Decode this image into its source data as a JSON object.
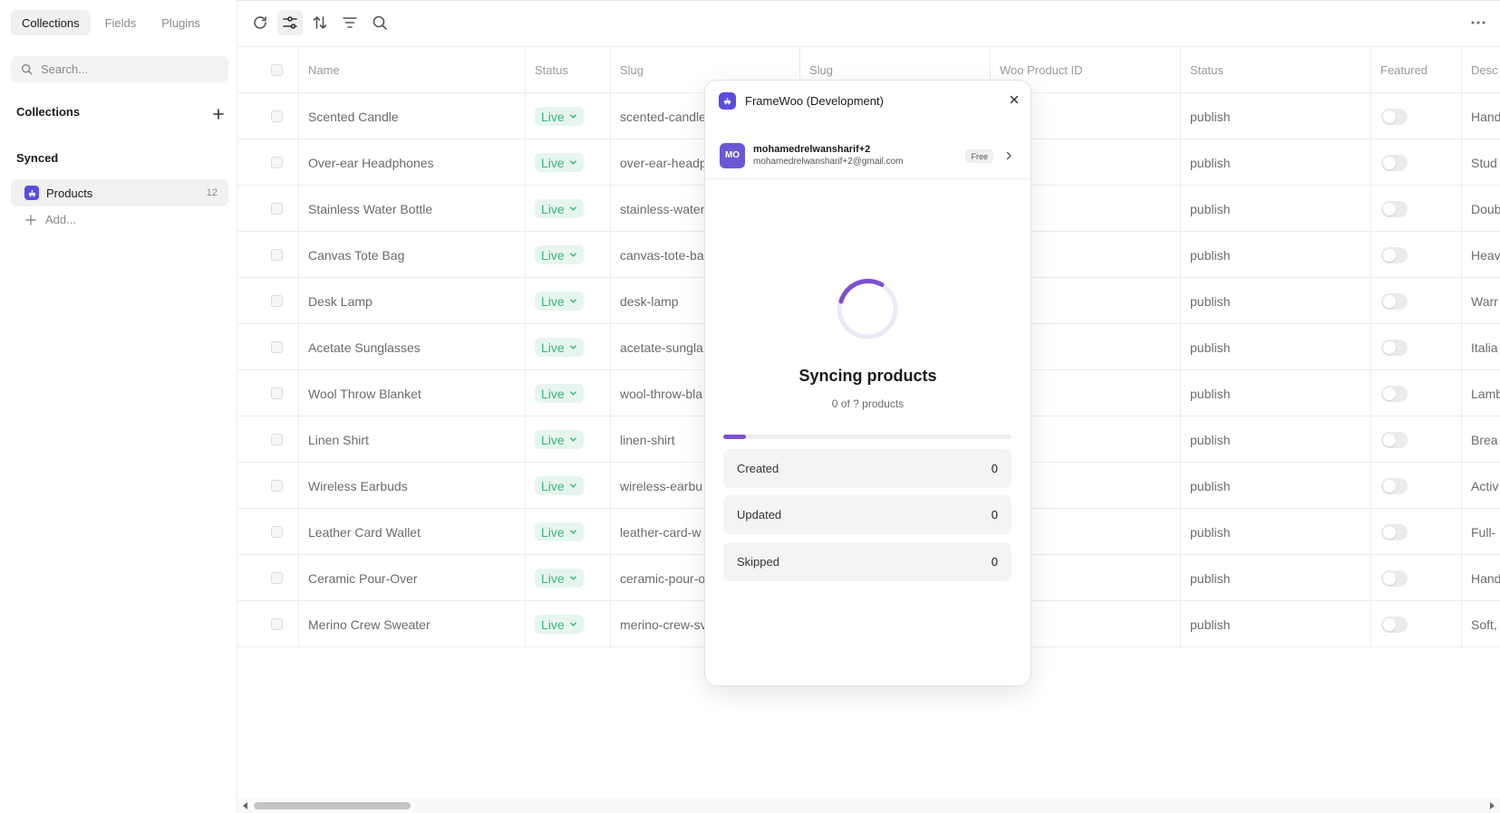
{
  "sidebar": {
    "tabs": [
      {
        "label": "Collections",
        "active": true
      },
      {
        "label": "Fields",
        "active": false
      },
      {
        "label": "Plugins",
        "active": false
      }
    ],
    "search_placeholder": "Search...",
    "collections_heading": "Collections",
    "synced_heading": "Synced",
    "synced_item": {
      "label": "Products",
      "count": "12"
    },
    "add_label": "Add..."
  },
  "toolbar": {
    "buttons": [
      "refresh-icon",
      "sliders-icon",
      "sort-icon",
      "filter-icon",
      "search-icon"
    ],
    "active_button": "sliders-icon",
    "more": "more-icon"
  },
  "table": {
    "columns": [
      "Name",
      "Status",
      "Slug",
      "Slug",
      "Woo Product ID",
      "Status",
      "Featured",
      "Desc"
    ],
    "rows": [
      {
        "name": "Scented Candle",
        "status": "Live",
        "slug": "scented-candle",
        "status2": "publish",
        "desc": "Hand"
      },
      {
        "name": "Over-ear Headphones",
        "status": "Live",
        "slug": "over-ear-headp",
        "status2": "publish",
        "desc": "Stud"
      },
      {
        "name": "Stainless Water Bottle",
        "status": "Live",
        "slug": "stainless-water",
        "status2": "publish",
        "desc": "Doub"
      },
      {
        "name": "Canvas Tote Bag",
        "status": "Live",
        "slug": "canvas-tote-ba",
        "status2": "publish",
        "desc": "Heav"
      },
      {
        "name": "Desk Lamp",
        "status": "Live",
        "slug": "desk-lamp",
        "status2": "publish",
        "desc": "Warr"
      },
      {
        "name": "Acetate Sunglasses",
        "status": "Live",
        "slug": "acetate-sungla",
        "status2": "publish",
        "desc": "Italia"
      },
      {
        "name": "Wool Throw Blanket",
        "status": "Live",
        "slug": "wool-throw-bla",
        "status2": "publish",
        "desc": "Lamb"
      },
      {
        "name": "Linen Shirt",
        "status": "Live",
        "slug": "linen-shirt",
        "status2": "publish",
        "desc": "Brea"
      },
      {
        "name": "Wireless Earbuds",
        "status": "Live",
        "slug": "wireless-earbu",
        "status2": "publish",
        "desc": "Activ"
      },
      {
        "name": "Leather Card Wallet",
        "status": "Live",
        "slug": "leather-card-w",
        "status2": "publish",
        "desc": "Full-"
      },
      {
        "name": "Ceramic Pour-Over",
        "status": "Live",
        "slug": "ceramic-pour-o",
        "status2": "publish",
        "desc": "Hand"
      },
      {
        "name": "Merino Crew Sweater",
        "status": "Live",
        "slug": "merino-crew-sv",
        "status2": "publish",
        "desc": "Soft,"
      }
    ]
  },
  "dialog": {
    "title": "FrameWoo (Development)",
    "account": {
      "initials": "MO",
      "name": "mohamedrelwansharif+2",
      "email": "mohamedrelwansharif+2@gmail.com",
      "plan": "Free"
    },
    "sync_title": "Syncing products",
    "sync_subtitle": "0 of ? products",
    "progress_fraction": 0.08,
    "stats": [
      {
        "label": "Created",
        "value": "0"
      },
      {
        "label": "Updated",
        "value": "0"
      },
      {
        "label": "Skipped",
        "value": "0"
      }
    ]
  },
  "colors": {
    "accent": "#5b4ce0",
    "progress": "#7d4fcf",
    "live_text": "#3bb37f",
    "live_bg": "#e6f6ef"
  }
}
